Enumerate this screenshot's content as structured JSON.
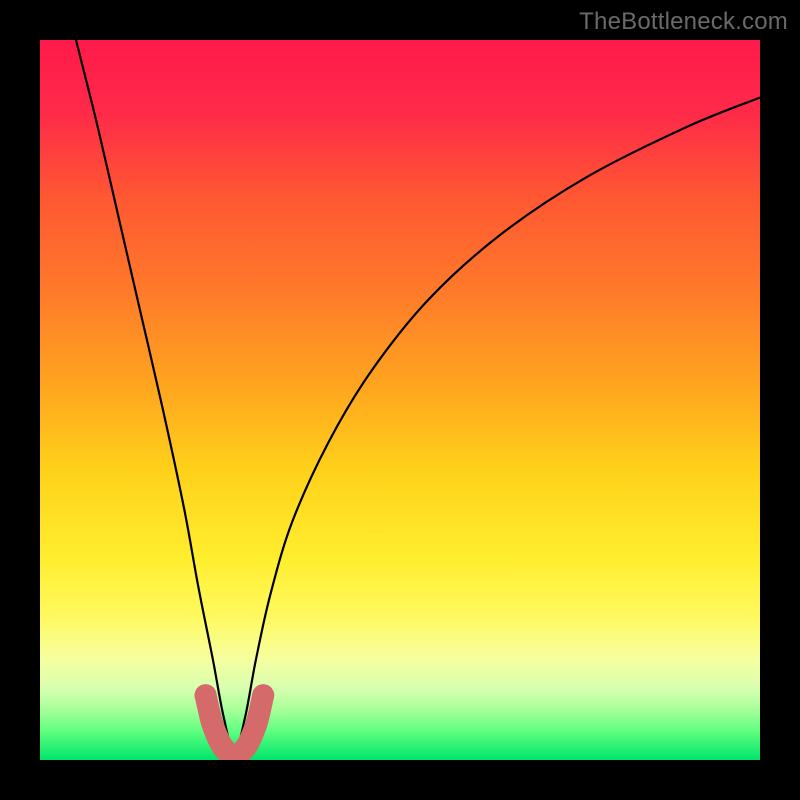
{
  "watermark": {
    "text": "TheBottleneck.com"
  },
  "gradient": {
    "stops": [
      {
        "pct": 0,
        "color": "#ff1a4b"
      },
      {
        "pct": 10,
        "color": "#ff2a49"
      },
      {
        "pct": 22,
        "color": "#ff5832"
      },
      {
        "pct": 35,
        "color": "#ff7a2a"
      },
      {
        "pct": 48,
        "color": "#ffa51f"
      },
      {
        "pct": 60,
        "color": "#ffd21a"
      },
      {
        "pct": 72,
        "color": "#ffee2e"
      },
      {
        "pct": 80,
        "color": "#fff95f"
      },
      {
        "pct": 86,
        "color": "#f6ffa0"
      },
      {
        "pct": 90,
        "color": "#d8ffb0"
      },
      {
        "pct": 93,
        "color": "#a8ff9a"
      },
      {
        "pct": 96,
        "color": "#5fff80"
      },
      {
        "pct": 100,
        "color": "#00e56a"
      }
    ]
  },
  "chart_data": {
    "type": "line",
    "title": "",
    "xlabel": "",
    "ylabel": "",
    "xlim": [
      0,
      100
    ],
    "ylim": [
      0,
      100
    ],
    "valley_x": 27,
    "series": [
      {
        "name": "bottleneck-curve",
        "x": [
          5,
          8,
          11,
          14,
          17,
          20,
          22,
          24,
          25.5,
          27,
          28.5,
          30,
          32,
          35,
          40,
          46,
          54,
          64,
          76,
          90,
          100
        ],
        "y": [
          100,
          88,
          75,
          62,
          49,
          35,
          24,
          14,
          6,
          1,
          6,
          14,
          23,
          33,
          44,
          54,
          64,
          73,
          81,
          88,
          92
        ]
      }
    ],
    "highlight": {
      "name": "valley-band",
      "color": "#d46a6a",
      "x": [
        23.0,
        23.8,
        24.6,
        25.4,
        26.2,
        27.0,
        27.8,
        28.6,
        29.4,
        30.2,
        31.0
      ],
      "y": [
        9.0,
        5.5,
        3.3,
        1.8,
        1.0,
        0.7,
        1.0,
        1.8,
        3.3,
        5.5,
        9.0
      ]
    }
  }
}
